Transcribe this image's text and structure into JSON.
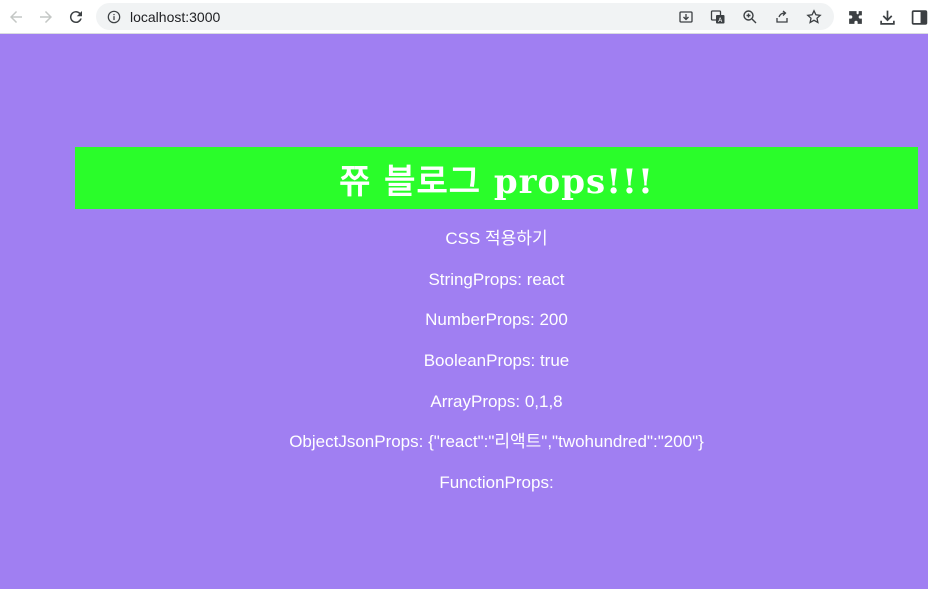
{
  "browser": {
    "url": "localhost:3000"
  },
  "page": {
    "title": "쮸 블로그 props!!!",
    "lines": {
      "css": "CSS 적용하기",
      "string": "StringProps: react",
      "number": "NumberProps: 200",
      "boolean": "BooleanProps: true",
      "array": "ArrayProps: 0,1,8",
      "object": "ObjectJsonProps: {\"react\":\"리액트\",\"twohundred\":\"200\"}",
      "function": "FunctionProps:"
    }
  },
  "colors": {
    "background": "#a07ff2",
    "banner": "#2afd2a",
    "text": "#ffffff"
  }
}
